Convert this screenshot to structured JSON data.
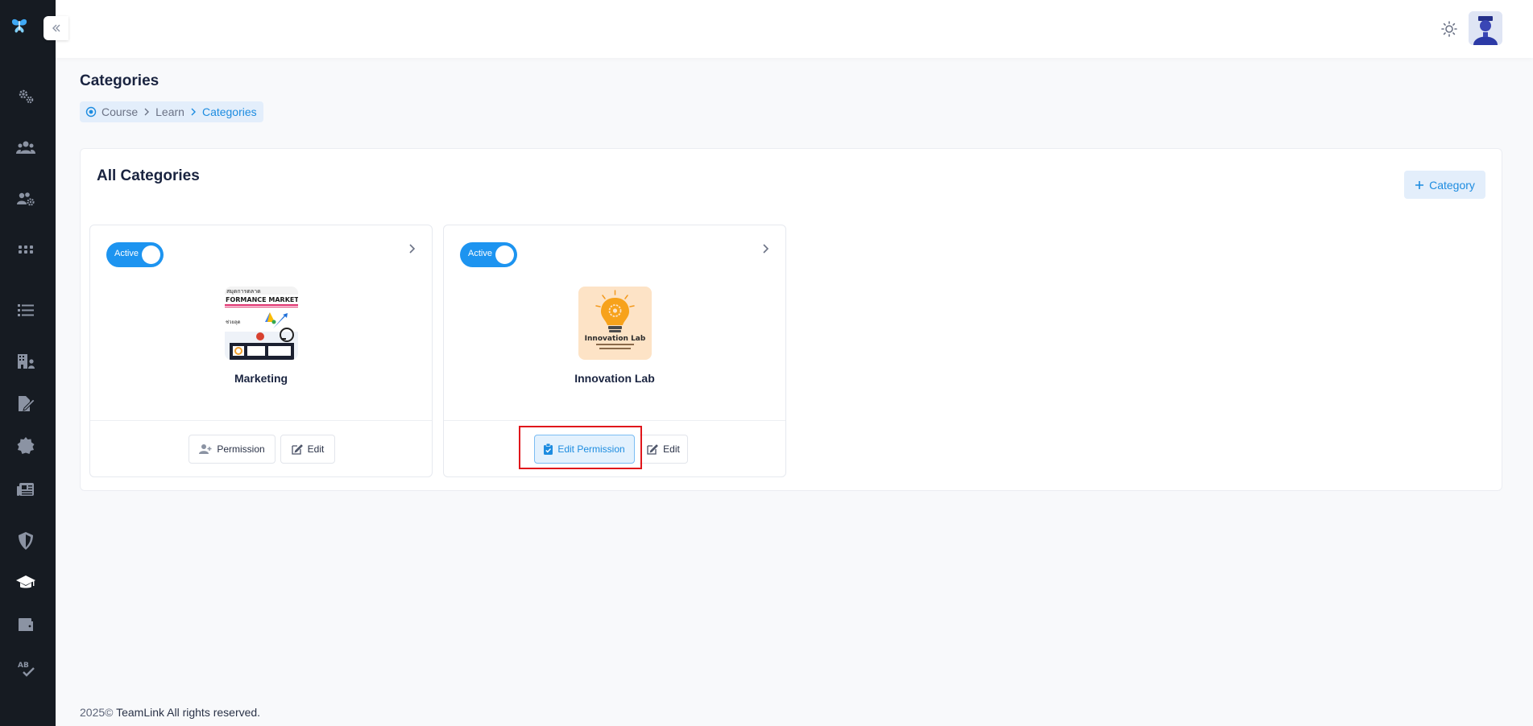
{
  "sidebar": {
    "logo_icon": "butterfly-logo-icon",
    "items": [
      {
        "icon": "gears-icon"
      },
      {
        "icon": "users-icon"
      },
      {
        "icon": "users-gear-icon"
      },
      {
        "icon": "grid-icon"
      },
      {
        "icon": "list-icon"
      },
      {
        "icon": "building-user-icon"
      },
      {
        "icon": "file-signature-icon"
      },
      {
        "icon": "badge-icon"
      },
      {
        "icon": "newspaper-icon"
      },
      {
        "icon": "shield-icon"
      },
      {
        "icon": "graduation-cap-icon",
        "active": true
      },
      {
        "icon": "wallet-icon"
      },
      {
        "icon": "spellcheck-icon"
      }
    ]
  },
  "header": {
    "theme_icon": "sun-icon",
    "avatar_icon": "user-avatar"
  },
  "page": {
    "title": "Categories",
    "breadcrumb": [
      "Course",
      "Learn",
      "Categories"
    ]
  },
  "panel": {
    "title": "All Categories",
    "add_button": "Category"
  },
  "cards": [
    {
      "status": "Active",
      "name": "Marketing",
      "buttons": [
        "Permission",
        "Edit"
      ]
    },
    {
      "status": "Active",
      "name": "Innovation Lab",
      "thumb_title": "Innovation Lab",
      "buttons": [
        "Edit Permission",
        "Edit"
      ]
    }
  ],
  "footer": {
    "year": "2025©",
    "text": "TeamLink All rights reserved."
  },
  "colors": {
    "sidebar_bg": "#161b22",
    "accent": "#1d94f0",
    "highlight": "#e0161b"
  }
}
